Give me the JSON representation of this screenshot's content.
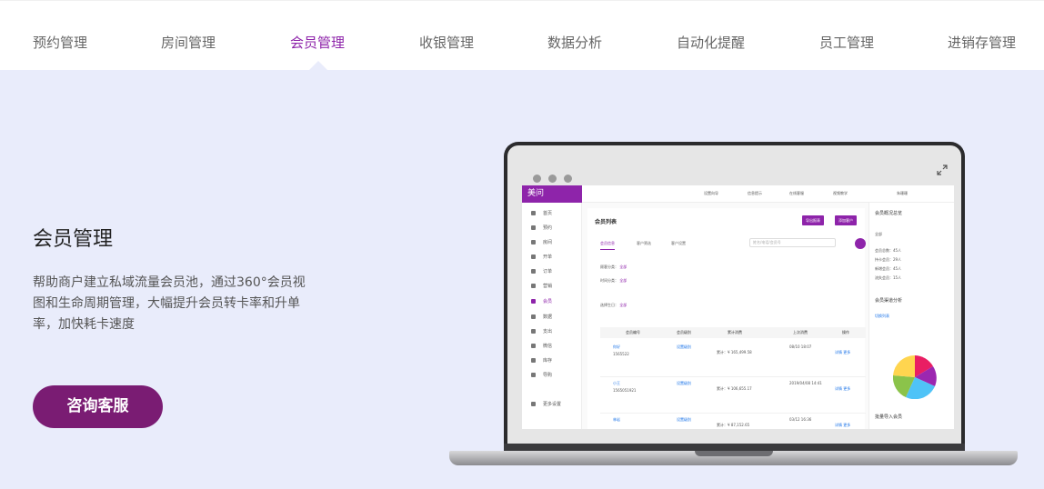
{
  "tabs": [
    {
      "label": "预约管理",
      "active": false
    },
    {
      "label": "房间管理",
      "active": false
    },
    {
      "label": "会员管理",
      "active": true
    },
    {
      "label": "收银管理",
      "active": false
    },
    {
      "label": "数据分析",
      "active": false
    },
    {
      "label": "自动化提醒",
      "active": false
    },
    {
      "label": "员工管理",
      "active": false
    },
    {
      "label": "进销存管理",
      "active": false
    }
  ],
  "hero": {
    "title": "会员管理",
    "description": "帮助商户建立私域流量会员池，通过360°会员视图和生命周期管理，大幅提升会员转卡率和升单率，加快耗卡速度",
    "cta_label": "咨询客服"
  },
  "colors": {
    "accent": "#8e24aa",
    "cta_bg": "#7a1c73",
    "hero_bg": "#e9ecfb",
    "tab_text": "#666666"
  },
  "screen": {
    "logo": "美问",
    "top_items": [
      "设置向导",
      "信息提示",
      "在线客服",
      "视频教学"
    ],
    "user_name": "朱珊珊",
    "sidebar": [
      "首页",
      "预约",
      "房间",
      "开单",
      "订单",
      "营销",
      "会员",
      "数据",
      "支出",
      "微信",
      "库存",
      "导购",
      "更多设置"
    ],
    "page_title": "会员列表",
    "btn_export": "导出报表",
    "btn_add": "添加客户",
    "tabs": [
      "会员信息",
      "客户筛选",
      "客户设置"
    ],
    "search_placeholder": "姓名/电话/会员号",
    "filter_member_type": "顾客分类：",
    "filter_all": "全部",
    "filter_time": "时间分类：",
    "filter_birthday": "选择生日：",
    "table_headers": [
      "会员编号",
      "会员级别",
      "累计消费",
      "上次消费",
      "操作"
    ],
    "rows": [
      {
        "name": "你好",
        "id": "1565522",
        "level": "设置级别",
        "total": "累计：¥ 165,499.58",
        "last": "08/10 18:07",
        "ops": "详情 更多"
      },
      {
        "name": "小王",
        "id": "1565051921",
        "level": "设置级别",
        "total": "累计：¥ 106,655.17",
        "last": "2019/04/08 14:41",
        "ops": "详情 更多"
      },
      {
        "name": "林岩",
        "id": "",
        "level": "设置级别",
        "total": "累计：¥ 87,152.65",
        "last": "03/12 16:36",
        "ops": "详情 更多"
      }
    ],
    "right_panel_title": "会员概况总览",
    "right_items": [
      "全部",
      "会员总数：45人",
      "持卡会员：29人",
      "新增会员：45人",
      "流失会员：15人"
    ],
    "right_section": "会员渠道分析",
    "right_sub": "切换列表",
    "right_bottom": "批量导入会员"
  }
}
